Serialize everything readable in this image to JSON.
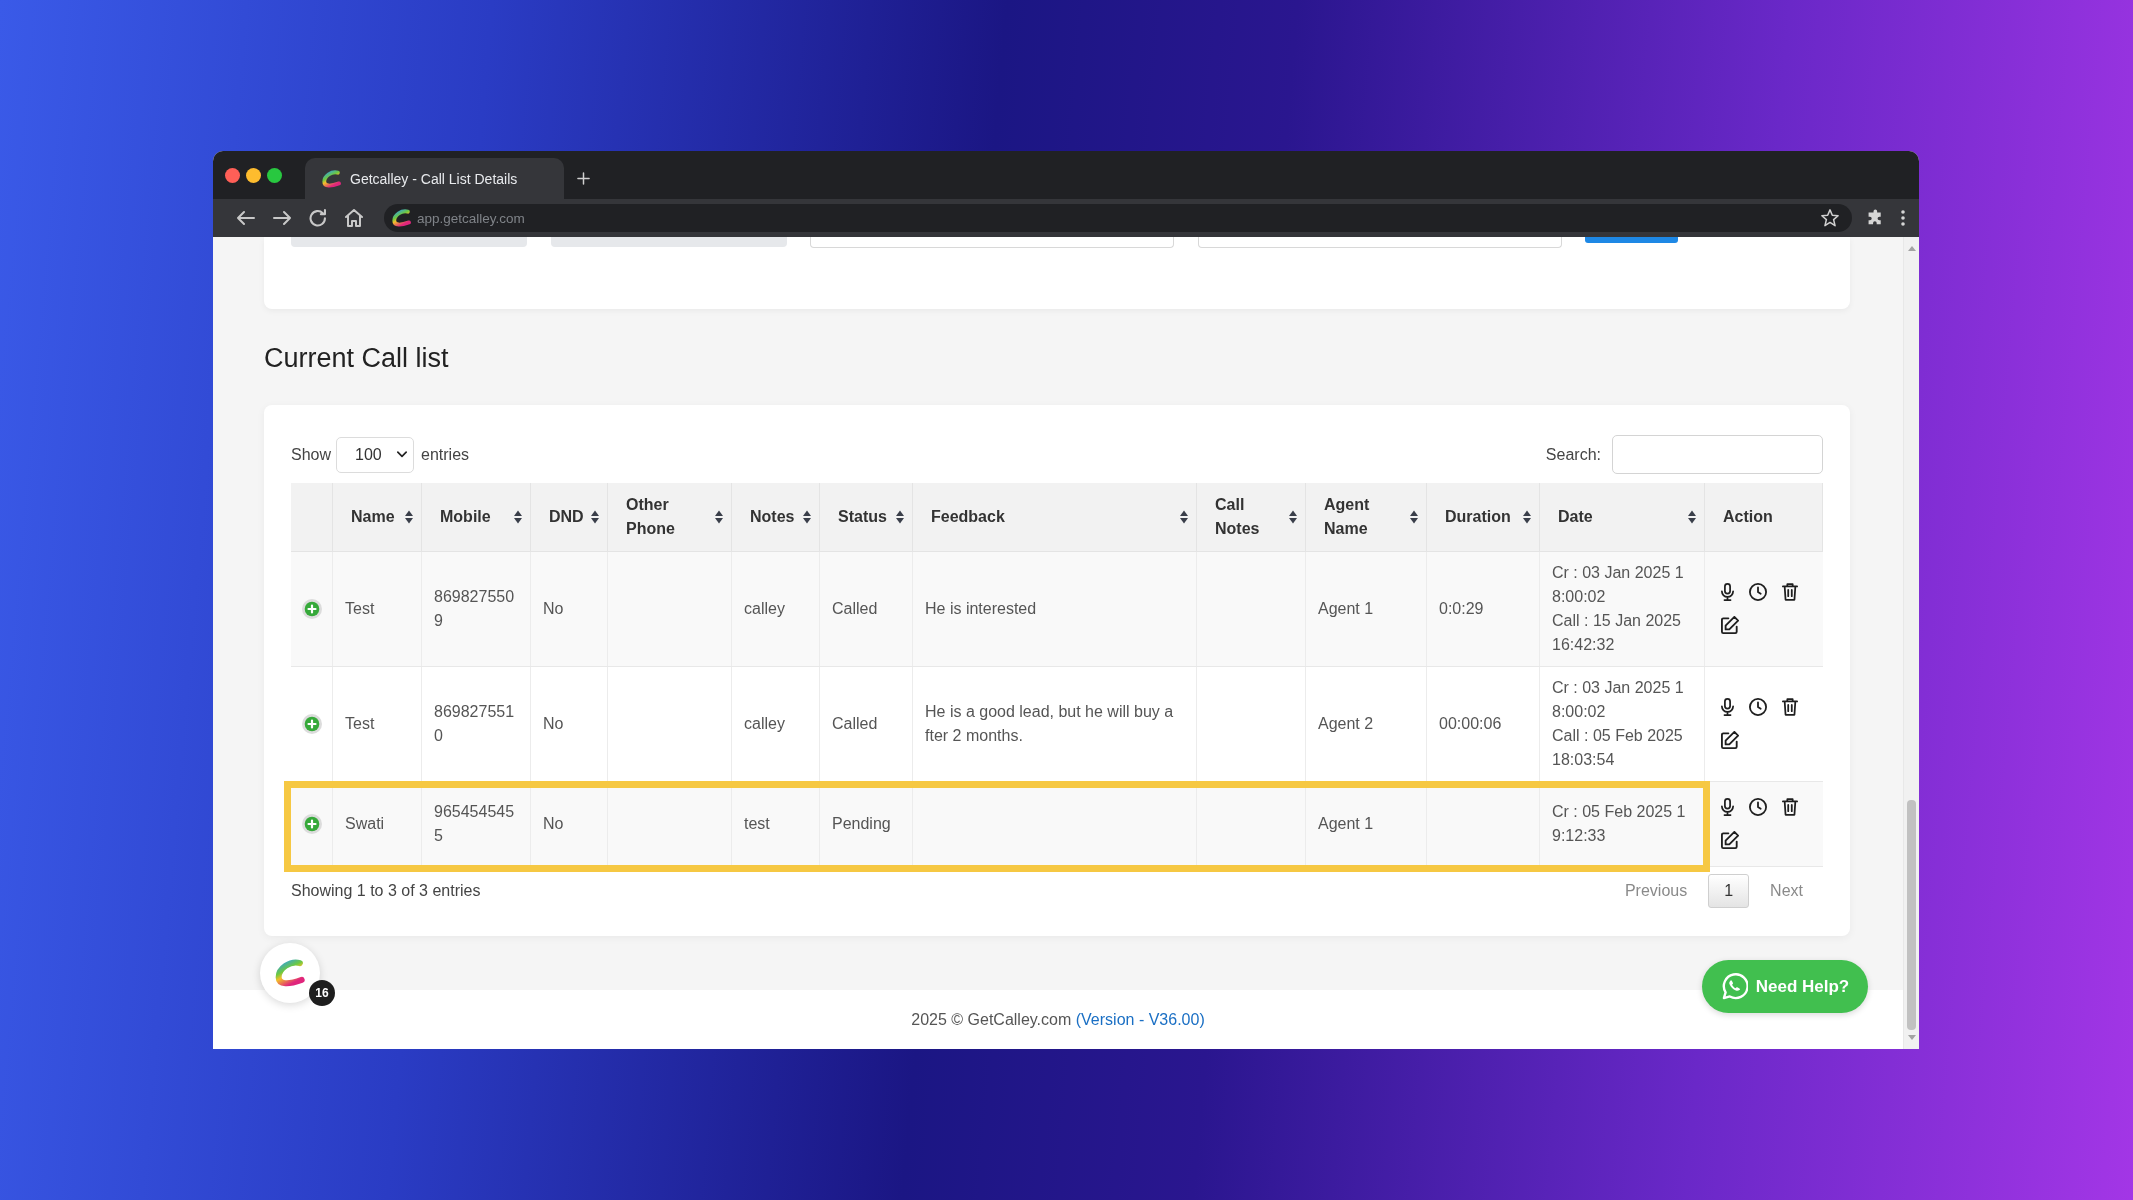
{
  "browser": {
    "tab": {
      "title": "Getcalley - Call List Details",
      "selected": true
    },
    "address": "app.getcalley.com"
  },
  "top_panel": {
    "controls": [
      {
        "kind": "filled_field"
      },
      {
        "kind": "filled_field"
      },
      {
        "kind": "field"
      },
      {
        "kind": "field"
      },
      {
        "kind": "button"
      }
    ]
  },
  "page_title": "Current Call list",
  "table_controls": {
    "show_label": "Show",
    "page_size": "100",
    "entries_label": "entries",
    "search_label": "Search:"
  },
  "table": {
    "columns": [
      {
        "sortable": false
      },
      {
        "label": "Name",
        "sortable": true
      },
      {
        "label": "Mobile",
        "sortable": true
      },
      {
        "label": "DND",
        "sortable": true
      },
      {
        "label": "Other Phone",
        "sortable": true
      },
      {
        "label": "Notes",
        "sortable": true
      },
      {
        "label": "Status",
        "sortable": true
      },
      {
        "label": "Feedback",
        "sortable": true
      },
      {
        "label": "Call Notes",
        "sortable": true
      },
      {
        "label": "Agent Name",
        "sortable": true
      },
      {
        "label": "Duration",
        "sortable": true
      },
      {
        "label": "Date",
        "sortable": true
      },
      {
        "label": "Action",
        "sortable": false
      }
    ],
    "rows": [
      {
        "expanded": false,
        "highlighted": false,
        "name": "Test",
        "mobile": "8698275509",
        "dnd": "No",
        "notes": "calley",
        "status": "Called",
        "feedback": "He is interested",
        "agent_name": "Agent 1",
        "duration": "0:0:29",
        "date": {
          "created": "Cr : 03 Jan 2025 18:00:02",
          "called": "Call : 15 Jan 2025 16:42:32"
        }
      },
      {
        "expanded": false,
        "highlighted": false,
        "name": "Test",
        "mobile": "8698275510",
        "dnd": "No",
        "notes": "calley",
        "status": "Called",
        "feedback": "He is a good lead, but he will buy after 2 months.",
        "agent_name": "Agent 2",
        "duration": "00:00:06",
        "date": {
          "created": "Cr : 03 Jan 2025 18:00:02",
          "called": "Call : 05 Feb 2025 18:03:54"
        }
      },
      {
        "expanded": false,
        "highlighted": true,
        "name": "Swati",
        "mobile": "9654545455",
        "dnd": "No",
        "notes": "test",
        "status": "Pending",
        "agent_name": "Agent 1",
        "date": {
          "created": "Cr : 05 Feb 2025 19:12:33"
        }
      }
    ]
  },
  "table_info": "Showing 1 to 3 of 3 entries",
  "pagination": {
    "previous": {
      "label": "Previous",
      "disabled": true
    },
    "pages": [
      {
        "label": "1",
        "selected": true
      }
    ],
    "next": {
      "label": "Next",
      "disabled": true
    }
  },
  "launcher": {
    "badge": "16"
  },
  "help_button": {
    "label": "Need Help?"
  },
  "footer": {
    "text": "2025 © GetCalley.com",
    "version_link": "(Version - V36.00)"
  }
}
